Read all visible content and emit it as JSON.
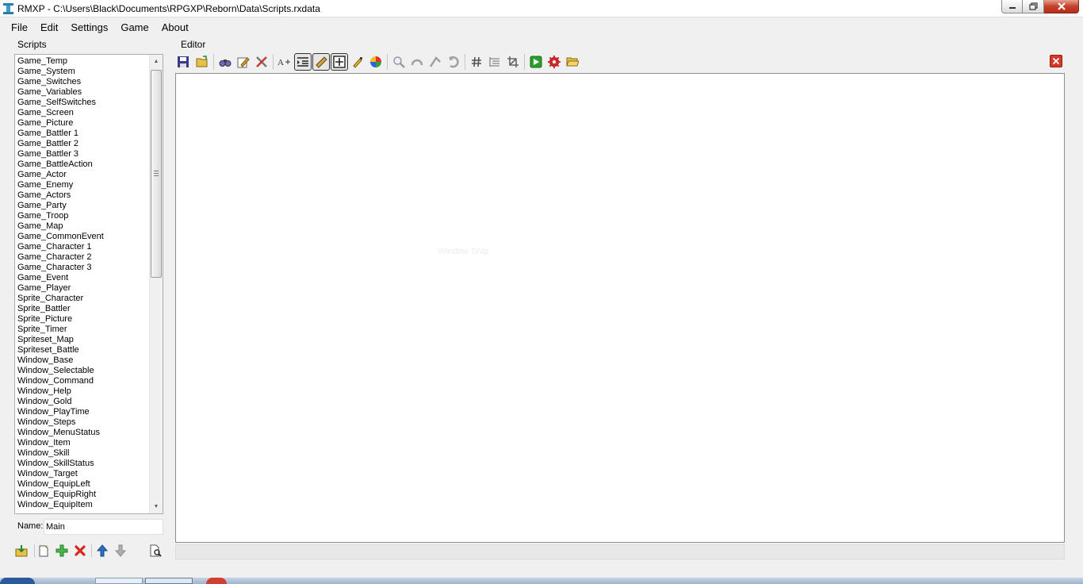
{
  "window": {
    "title": "RMXP - C:\\Users\\Black\\Documents\\RPGXP\\Reborn\\Data\\Scripts.rxdata"
  },
  "menu": [
    "File",
    "Edit",
    "Settings",
    "Game",
    "About"
  ],
  "scripts_panel": {
    "label": "Scripts",
    "items": [
      "Game_Temp",
      "Game_System",
      "Game_Switches",
      "Game_Variables",
      "Game_SelfSwitches",
      "Game_Screen",
      "Game_Picture",
      "Game_Battler 1",
      "Game_Battler 2",
      "Game_Battler 3",
      "Game_BattleAction",
      "Game_Actor",
      "Game_Enemy",
      "Game_Actors",
      "Game_Party",
      "Game_Troop",
      "Game_Map",
      "Game_CommonEvent",
      "Game_Character 1",
      "Game_Character 2",
      "Game_Character 3",
      "Game_Event",
      "Game_Player",
      "Sprite_Character",
      "Sprite_Battler",
      "Sprite_Picture",
      "Sprite_Timer",
      "Spriteset_Map",
      "Spriteset_Battle",
      "Window_Base",
      "Window_Selectable",
      "Window_Command",
      "Window_Help",
      "Window_Gold",
      "Window_PlayTime",
      "Window_Steps",
      "Window_MenuStatus",
      "Window_Item",
      "Window_Skill",
      "Window_SkillStatus",
      "Window_Target",
      "Window_EquipLeft",
      "Window_EquipRight",
      "Window_EquipItem"
    ],
    "name_label": "Name:",
    "name_value": "Main"
  },
  "editor": {
    "label": "Editor",
    "ghost_text": "Window Snip"
  },
  "colors": {
    "editor_bg": "#ffffff",
    "window_bg": "#f0f0f0",
    "close_red": "#c4412b"
  }
}
